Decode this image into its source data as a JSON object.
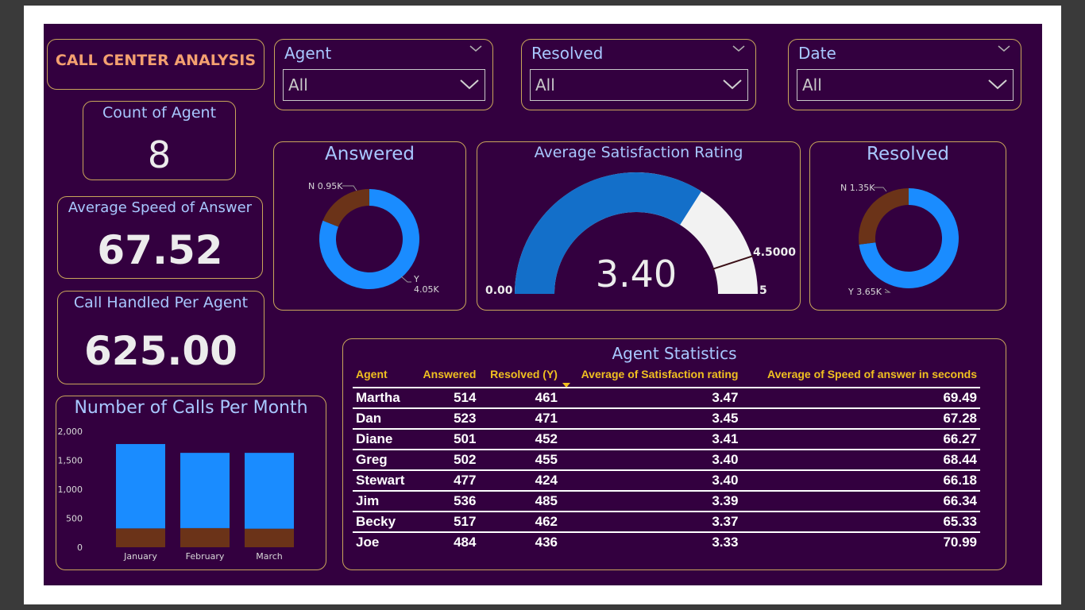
{
  "dashboard": {
    "title": "CALL CENTER ANALYSIS"
  },
  "slicers": [
    {
      "label": "Agent",
      "value": "All"
    },
    {
      "label": "Resolved",
      "value": "All"
    },
    {
      "label": "Date",
      "value": "All"
    }
  ],
  "kpis": {
    "count_of_agent": {
      "label": "Count of Agent",
      "value": "8"
    },
    "avg_speed": {
      "label": "Average Speed of Answer",
      "value": "67.52"
    },
    "call_handled": {
      "label": "Call Handled Per Agent",
      "value": "625.00"
    }
  },
  "colors": {
    "blue": "#1a8cff",
    "brown": "#6b3318",
    "gauge_blue": "#136fc9",
    "gauge_rest": "#f2f2f2",
    "border": "#c9a65b"
  },
  "chart_data": [
    {
      "type": "pie",
      "title": "Answered",
      "categories": [
        "Y",
        "N"
      ],
      "values": [
        4050,
        950
      ],
      "data_labels": [
        "Y 4.05K",
        "N 0.95K"
      ]
    },
    {
      "type": "pie",
      "title": "Resolved",
      "categories": [
        "Y",
        "N"
      ],
      "values": [
        3650,
        1350
      ],
      "data_labels": [
        "Y 3.65K",
        "N 1.35K"
      ]
    },
    {
      "type": "gauge",
      "title": "Average Satisfaction Rating",
      "value": 3.4,
      "value_label": "3.40",
      "min": 0,
      "min_label": "0.00",
      "max": 5,
      "max_label": "5",
      "target": 4.5,
      "target_label": "4.5000"
    },
    {
      "type": "bar",
      "title": "Number of Calls Per Month",
      "categories": [
        "January",
        "February",
        "March"
      ],
      "series": [
        {
          "values": [
            1455,
            1298,
            1308
          ]
        },
        {
          "values": [
            325,
            330,
            320
          ]
        }
      ],
      "stacked": true,
      "ylim": [
        0,
        2000
      ],
      "yticks": [
        0,
        500,
        1000,
        1500,
        2000
      ],
      "ytick_labels": [
        "0",
        "500",
        "1,000",
        "1,500",
        "2,000"
      ]
    },
    {
      "type": "table",
      "title": "Agent Statistics",
      "columns": [
        "Agent",
        "Answered",
        "Resolved (Y)",
        "Average of Satisfaction rating",
        "Average of Speed of answer in seconds"
      ],
      "rows": [
        [
          "Martha",
          "514",
          "461",
          "3.47",
          "69.49"
        ],
        [
          "Dan",
          "523",
          "471",
          "3.45",
          "67.28"
        ],
        [
          "Diane",
          "501",
          "452",
          "3.41",
          "66.27"
        ],
        [
          "Greg",
          "502",
          "455",
          "3.40",
          "68.44"
        ],
        [
          "Stewart",
          "477",
          "424",
          "3.40",
          "66.18"
        ],
        [
          "Jim",
          "536",
          "485",
          "3.39",
          "66.34"
        ],
        [
          "Becky",
          "517",
          "462",
          "3.37",
          "65.33"
        ],
        [
          "Joe",
          "484",
          "436",
          "3.33",
          "70.99"
        ]
      ]
    }
  ]
}
